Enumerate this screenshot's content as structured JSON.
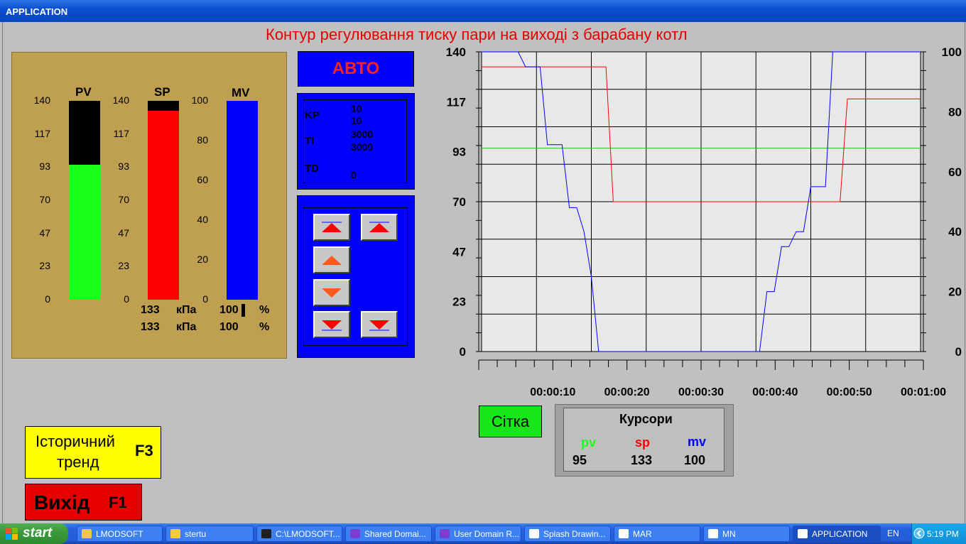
{
  "window": {
    "title": "APPLICATION"
  },
  "page": {
    "title": "Контур регулювання тиску пари на виході з барабану котл"
  },
  "gauges": {
    "pv": {
      "label": "PV",
      "ticks": [
        "140",
        "117",
        "93",
        "70",
        "47",
        "23",
        "0"
      ],
      "max": 140,
      "value": 95,
      "color": "#19ff19"
    },
    "sp": {
      "label": "SP",
      "ticks": [
        "140",
        "117",
        "93",
        "70",
        "47",
        "23",
        "0"
      ],
      "max": 140,
      "value": 133,
      "color": "#ff0000",
      "readout1": "133",
      "readout2": "133",
      "unit1": "кПа",
      "unit2": "кПа"
    },
    "mv": {
      "label": "MV",
      "ticks": [
        "100",
        "80",
        "60",
        "40",
        "20",
        "0"
      ],
      "max": 100,
      "value": 100,
      "color": "#0000ff",
      "readout1": "100",
      "readout2": "100",
      "unit1": "%",
      "unit2": "%"
    }
  },
  "mode": {
    "label": "АВТО"
  },
  "params": {
    "kp_label": "KP",
    "kp_value1": "10",
    "kp_value2": "10",
    "ti_label": "TI",
    "ti_value1": "3000",
    "ti_value2": "3000",
    "td_label": "TD",
    "td_value": "0"
  },
  "buttons": {
    "up_fast": "arrow-up-fast-icon",
    "up_fast2": "arrow-up-fast-icon",
    "up": "arrow-up-icon",
    "down": "arrow-down-icon",
    "down_fast": "arrow-down-fast-icon",
    "down_fast2": "arrow-down-fast-icon"
  },
  "chart_data": {
    "type": "line",
    "left_axis_ticks": [
      "140",
      "117",
      "93",
      "70",
      "47",
      "23",
      "0"
    ],
    "right_axis_ticks": [
      "100",
      "80",
      "60",
      "40",
      "20",
      "0"
    ],
    "left_ylim": [
      0,
      140
    ],
    "right_ylim": [
      0,
      100
    ],
    "x_ticks": [
      "00:00:10",
      "00:00:20",
      "00:00:30",
      "00:00:40",
      "00:00:50",
      "00:01:00"
    ],
    "xlim_seconds": [
      0,
      60
    ],
    "grid": true,
    "series": [
      {
        "color": "#19c819",
        "axis": "left",
        "points": [
          [
            0,
            95
          ],
          [
            60,
            95
          ]
        ]
      },
      {
        "color": "#ff0000",
        "axis": "left",
        "points": [
          [
            0,
            133
          ],
          [
            17,
            133
          ],
          [
            18,
            70
          ],
          [
            49,
            70
          ],
          [
            50,
            118
          ],
          [
            60,
            118
          ]
        ]
      },
      {
        "color": "#0000ff",
        "axis": "right",
        "points": [
          [
            0,
            100
          ],
          [
            5,
            100
          ],
          [
            6,
            95
          ],
          [
            8,
            95
          ],
          [
            9,
            69
          ],
          [
            11,
            69
          ],
          [
            12,
            48
          ],
          [
            13,
            48
          ],
          [
            14,
            40
          ],
          [
            15,
            25
          ],
          [
            16,
            0
          ],
          [
            38,
            0
          ],
          [
            39,
            20
          ],
          [
            40,
            20
          ],
          [
            41,
            35
          ],
          [
            42,
            35
          ],
          [
            43,
            40
          ],
          [
            44,
            40
          ],
          [
            45,
            55
          ],
          [
            47,
            55
          ],
          [
            48,
            100
          ],
          [
            60,
            100
          ]
        ]
      }
    ]
  },
  "grid_button": {
    "label": "Сітка"
  },
  "cursors": {
    "title": "Курсори",
    "pv_label": "pv",
    "sp_label": "sp",
    "mv_label": "mv",
    "pv_value": "95",
    "sp_value": "133",
    "mv_value": "100",
    "pv_color": "#19ff19",
    "sp_color": "#ff0000",
    "mv_color": "#0000ff"
  },
  "history_button": {
    "line1": "Історичний",
    "line2": "тренд",
    "key": "F3"
  },
  "exit_button": {
    "label": "Вихід",
    "key": "F1"
  },
  "taskbar": {
    "start": "start",
    "items": [
      {
        "label": "LMODSOFT",
        "icon": "folder-icon"
      },
      {
        "label": "stertu",
        "icon": "folder-icon"
      },
      {
        "label": "C:\\LMODSOFT...",
        "icon": "console-icon"
      },
      {
        "label": "Shared Domai...",
        "icon": "app-icon"
      },
      {
        "label": "User Domain R...",
        "icon": "app-icon"
      },
      {
        "label": "Splash Drawin...",
        "icon": "window-icon"
      },
      {
        "label": "MAR",
        "icon": "window-icon"
      },
      {
        "label": "MN",
        "icon": "window-icon"
      },
      {
        "label": "APPLICATION",
        "icon": "window-icon"
      }
    ],
    "lang": "EN",
    "clock": "5:19 PM"
  }
}
